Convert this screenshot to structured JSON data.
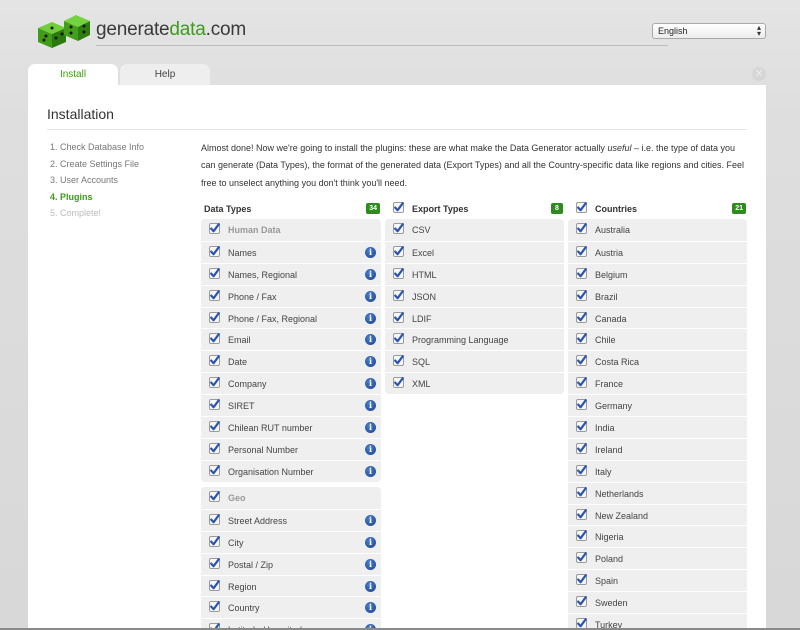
{
  "brand": {
    "prefix": "generate",
    "highlight": "data",
    "suffix": ".com"
  },
  "language": {
    "selected": "English"
  },
  "tabs": [
    {
      "label": "Install"
    },
    {
      "label": "Help"
    }
  ],
  "page_title": "Installation",
  "steps": [
    "1. Check Database Info",
    "2. Create Settings File",
    "3. User Accounts",
    "4. Plugins",
    "5. Complete!"
  ],
  "intro": {
    "before": "Almost done! Now we're going to install the plugins: these are what make the Data Generator actually ",
    "emphasis": "useful",
    "after": " – i.e. the type of data you can generate (Data Types), the format of the generated data (Export Types) and all the Country-specific data like regions and cities. Feel free to unselect anything you don't think you'll need."
  },
  "columns": {
    "data_types": {
      "title": "Data Types",
      "count": "34"
    },
    "export_types": {
      "title": "Export Types",
      "count": "8"
    },
    "countries": {
      "title": "Countries",
      "count": "21"
    }
  },
  "data_types": {
    "human_group": "Human Data",
    "human": [
      "Names",
      "Names, Regional",
      "Phone / Fax",
      "Phone / Fax, Regional",
      "Email",
      "Date",
      "Company",
      "SIRET",
      "Chilean RUT number",
      "Personal Number",
      "Organisation Number"
    ],
    "geo_group": "Geo",
    "geo": [
      "Street Address",
      "City",
      "Postal / Zip",
      "Region",
      "Country",
      "Latitude / Longitude"
    ]
  },
  "export_types": [
    "CSV",
    "Excel",
    "HTML",
    "JSON",
    "LDIF",
    "Programming Language",
    "SQL",
    "XML"
  ],
  "countries": [
    "Australia",
    "Austria",
    "Belgium",
    "Brazil",
    "Canada",
    "Chile",
    "Costa Rica",
    "France",
    "Germany",
    "India",
    "Ireland",
    "Italy",
    "Netherlands",
    "New Zealand",
    "Nigeria",
    "Poland",
    "Spain",
    "Sweden",
    "Turkey"
  ],
  "icons": {
    "checkbox": "checkbox-checked-icon",
    "info": "info-icon",
    "logo": "dice-logo-icon",
    "close": "close-icon"
  },
  "colors": {
    "brand_green": "#3c9c1a",
    "badge_green": "#2e8b1e",
    "info_blue": "#1b3f8f",
    "checkbox_blue": "#2c55b0"
  }
}
